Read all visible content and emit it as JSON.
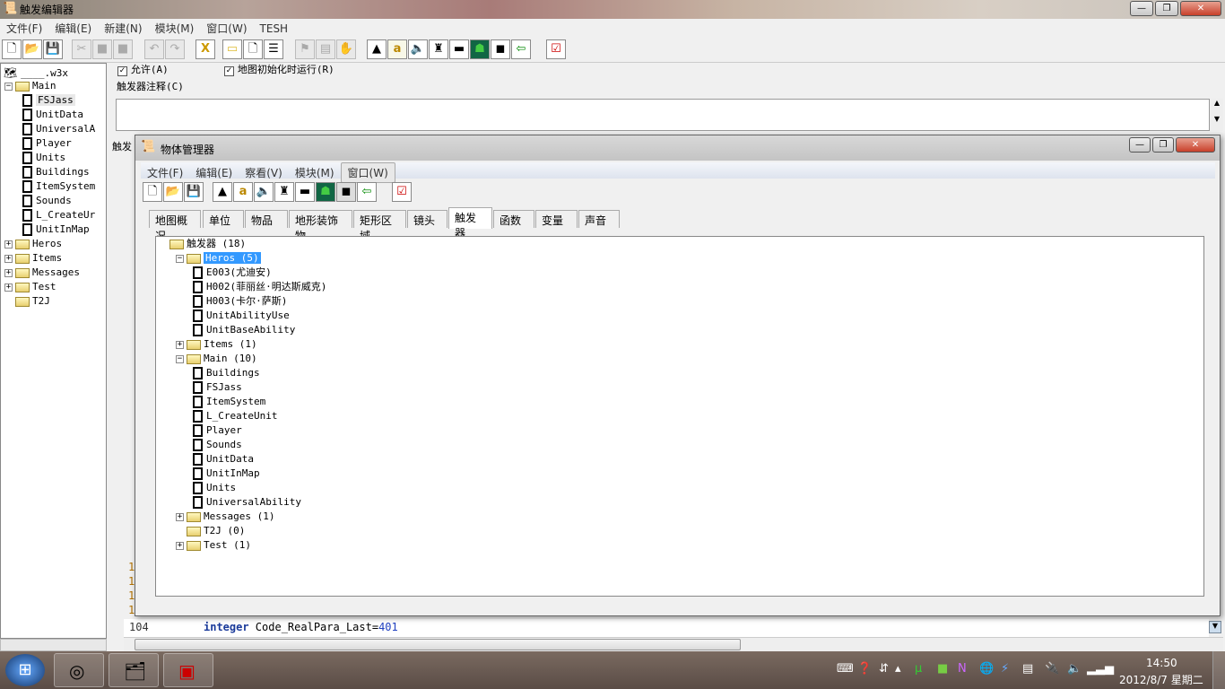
{
  "app": {
    "title": "触发编辑器",
    "menu": [
      "文件(F)",
      "编辑(E)",
      "新建(N)",
      "模块(M)",
      "窗口(W)",
      "TESH"
    ]
  },
  "trigger": {
    "enabled_label": "允许(A)",
    "run_on_init_label": "地图初始化时运行(R)",
    "comment_label": "触发器注释(C)",
    "enabled": true,
    "run_on_init": true,
    "hidden_label": "触发"
  },
  "left_tree": {
    "root": "____.w3x",
    "items": [
      {
        "label": "Main",
        "type": "folder",
        "expanded": true,
        "level": 0
      },
      {
        "label": "FSJass",
        "type": "doc",
        "level": 1,
        "highlight": true
      },
      {
        "label": "UnitData",
        "type": "doc",
        "level": 1
      },
      {
        "label": "UniversalA",
        "type": "doc",
        "level": 1
      },
      {
        "label": "Player",
        "type": "doc",
        "level": 1
      },
      {
        "label": "Units",
        "type": "doc",
        "level": 1
      },
      {
        "label": "Buildings",
        "type": "doc",
        "level": 1
      },
      {
        "label": "ItemSystem",
        "type": "doc",
        "level": 1
      },
      {
        "label": "Sounds",
        "type": "doc",
        "level": 1
      },
      {
        "label": "L_CreateUr",
        "type": "doc",
        "level": 1
      },
      {
        "label": "UnitInMap",
        "type": "doc",
        "level": 1
      },
      {
        "label": "Heros",
        "type": "folder",
        "level": 0
      },
      {
        "label": "Items",
        "type": "folder",
        "level": 0
      },
      {
        "label": "Messages",
        "type": "folder",
        "level": 0
      },
      {
        "label": "Test",
        "type": "folder",
        "level": 0
      },
      {
        "label": "T2J",
        "type": "folder",
        "level": 0,
        "nopm": true
      }
    ]
  },
  "code": {
    "line_number": "104",
    "keyword": "integer",
    "text": " Code_RealPara_Last=",
    "value": "401",
    "partial_line_numbers": [
      "1",
      "1",
      "1",
      "1"
    ]
  },
  "object_manager": {
    "title": "物体管理器",
    "menu": [
      "文件(F)",
      "编辑(E)",
      "察看(V)",
      "模块(M)",
      "窗口(W)"
    ],
    "tabs": [
      "地图概况",
      "单位",
      "物品",
      "地形装饰物",
      "矩形区域",
      "镜头",
      "触发器",
      "函数",
      "变量",
      "声音"
    ],
    "active_tab": "触发器",
    "tree": [
      {
        "label": "触发器 (18)",
        "type": "folder",
        "level": 0,
        "nopm": true
      },
      {
        "label": "Heros (5)",
        "type": "folder",
        "level": 1,
        "expanded": true,
        "selected": true
      },
      {
        "label": "E003(尤迪安)",
        "type": "doc",
        "level": 2
      },
      {
        "label": "H002(菲丽丝·明达斯威克)",
        "type": "doc",
        "level": 2
      },
      {
        "label": "H003(卡尔·萨斯)",
        "type": "doc",
        "level": 2
      },
      {
        "label": "UnitAbilityUse",
        "type": "doc",
        "level": 2
      },
      {
        "label": "UnitBaseAbility",
        "type": "doc",
        "level": 2
      },
      {
        "label": "Items (1)",
        "type": "folder",
        "level": 1
      },
      {
        "label": "Main (10)",
        "type": "folder",
        "level": 1,
        "expanded": true
      },
      {
        "label": "Buildings",
        "type": "doc",
        "level": 2
      },
      {
        "label": "FSJass",
        "type": "doc",
        "level": 2
      },
      {
        "label": "ItemSystem",
        "type": "doc",
        "level": 2
      },
      {
        "label": "L_CreateUnit",
        "type": "doc",
        "level": 2
      },
      {
        "label": "Player",
        "type": "doc",
        "level": 2
      },
      {
        "label": "Sounds",
        "type": "doc",
        "level": 2
      },
      {
        "label": "UnitData",
        "type": "doc",
        "level": 2
      },
      {
        "label": "UnitInMap",
        "type": "doc",
        "level": 2
      },
      {
        "label": "Units",
        "type": "doc",
        "level": 2
      },
      {
        "label": "UniversalAbility",
        "type": "doc",
        "level": 2
      },
      {
        "label": "Messages (1)",
        "type": "folder",
        "level": 1
      },
      {
        "label": "T2J (0)",
        "type": "folder",
        "level": 1,
        "nopm": true
      },
      {
        "label": "Test (1)",
        "type": "folder",
        "level": 1
      }
    ]
  },
  "taskbar": {
    "time": "14:50",
    "date": "2012/8/7 星期二",
    "apps": [
      "chrome",
      "explorer",
      "app"
    ]
  },
  "colors": {
    "selection": "#3399ff",
    "keyword": "#1a3a9a",
    "number": "#2040c0",
    "line_number": "#b07000"
  }
}
